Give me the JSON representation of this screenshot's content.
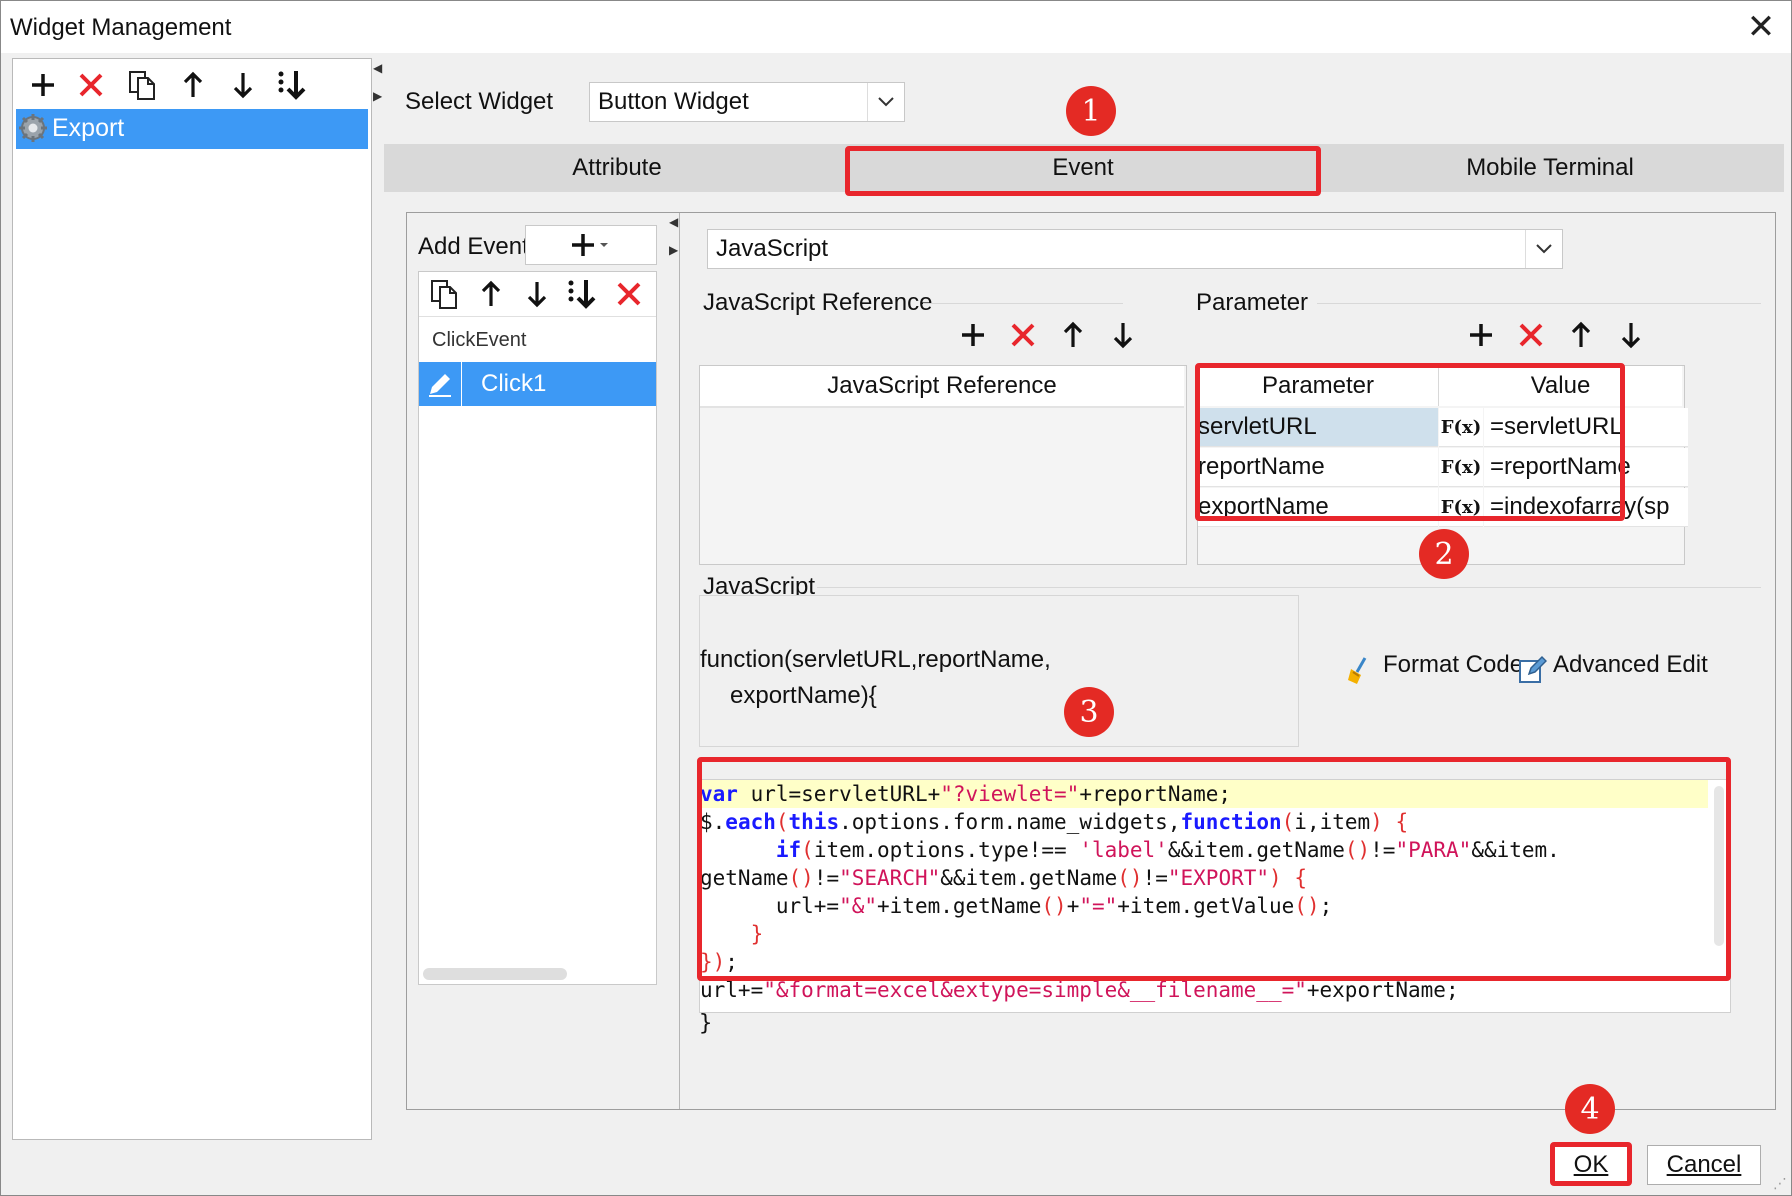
{
  "window": {
    "title": "Widget Management"
  },
  "left_toolbar": {
    "icons": [
      "plus-icon",
      "delete-icon",
      "copy-icon",
      "arrow-up-icon",
      "arrow-down-icon",
      "move-bottom-icon"
    ]
  },
  "tree": {
    "items": [
      {
        "label": "Export",
        "selected": true
      }
    ]
  },
  "select_widget": {
    "label": "Select Widget",
    "value": "Button Widget"
  },
  "tabs": [
    {
      "label": "Attribute"
    },
    {
      "label": "Event"
    },
    {
      "label": "Mobile Terminal"
    }
  ],
  "events": {
    "add_label": "Add Event",
    "group": "ClickEvent",
    "items": [
      {
        "label": "Click1",
        "selected": true
      }
    ]
  },
  "script_type": {
    "value": "JavaScript"
  },
  "js_reference": {
    "group_label": "JavaScript Reference",
    "column": "JavaScript Reference"
  },
  "parameter": {
    "group_label": "Parameter",
    "columns": [
      "Parameter",
      "Value"
    ],
    "rows": [
      {
        "name": "servletURL",
        "value": "=servletURL"
      },
      {
        "name": "reportName",
        "value": "=reportName"
      },
      {
        "name": "exportName",
        "value": "=indexofarray(sp"
      }
    ],
    "formula_glyph": "F(x)"
  },
  "javascript": {
    "group_label": "JavaScript",
    "signature_line1": "function(servletURL,reportName,",
    "signature_line2": "exportName){",
    "format_code": "Format Code",
    "advanced_edit": "Advanced Edit",
    "closing": "}"
  },
  "annotations": [
    "1",
    "2",
    "3",
    "4"
  ],
  "buttons": {
    "ok": "OK",
    "cancel": "Cancel"
  },
  "colors": {
    "selection": "#3d99f5",
    "highlight_red": "#e8262c",
    "badge_red": "#e42a24",
    "param_selected": "#cfe0ec",
    "code_highlight": "#ffffc8"
  }
}
